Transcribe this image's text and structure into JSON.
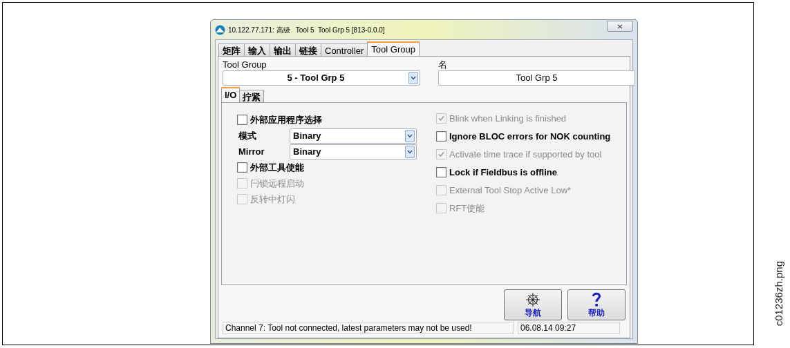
{
  "window": {
    "title": "10.122.77.171: 高级   Tool 5  Tool Grp 5 [813-0.0.0]"
  },
  "tabs": [
    {
      "label": "矩阵",
      "selected": false
    },
    {
      "label": "输入",
      "selected": false
    },
    {
      "label": "输出",
      "selected": false
    },
    {
      "label": "链接",
      "selected": false
    },
    {
      "label": "Controller",
      "selected": false
    },
    {
      "label": "Tool Group",
      "selected": true
    }
  ],
  "tool_group": {
    "label": "Tool Group",
    "value": "5 - Tool Grp 5"
  },
  "name": {
    "label": "名",
    "value": "Tool Grp 5"
  },
  "sub_tabs": [
    {
      "label": "I/O",
      "selected": true
    },
    {
      "label": "拧紧",
      "selected": false
    }
  ],
  "left_items": [
    {
      "kind": "checkbox",
      "label": "外部应用程序选择",
      "checked": false,
      "disabled": false
    },
    {
      "kind": "select",
      "label": "模式",
      "value": "Binary"
    },
    {
      "kind": "select",
      "label": "Mirror",
      "value": "Binary"
    },
    {
      "kind": "checkbox",
      "label": "外部工具使能",
      "checked": false,
      "disabled": false
    },
    {
      "kind": "checkbox",
      "label": "闩锁远程启动",
      "checked": false,
      "disabled": true
    },
    {
      "kind": "checkbox",
      "label": "反转中灯闪",
      "checked": false,
      "disabled": true
    }
  ],
  "right_items": [
    {
      "label": "Blink when Linking is finished",
      "checked": true,
      "disabled": true
    },
    {
      "label": "Ignore BLOC errors for NOK counting",
      "checked": false,
      "disabled": false
    },
    {
      "label": "Activate time trace if supported by tool",
      "checked": true,
      "disabled": true
    },
    {
      "label": "Lock if Fieldbus is offline",
      "checked": false,
      "disabled": false
    },
    {
      "label": "External Tool Stop Active Low*",
      "checked": false,
      "disabled": true
    },
    {
      "label": "RFT使能",
      "checked": false,
      "disabled": true
    }
  ],
  "buttons": [
    {
      "kind": "navigation",
      "label": "导航"
    },
    {
      "kind": "help",
      "label": "帮助"
    }
  ],
  "status_bar": {
    "message": "Channel 7: Tool not connected, latest parameters may not be used!",
    "datetime": "06.08.14 09:27"
  },
  "file_label": "c01236zh.png"
}
